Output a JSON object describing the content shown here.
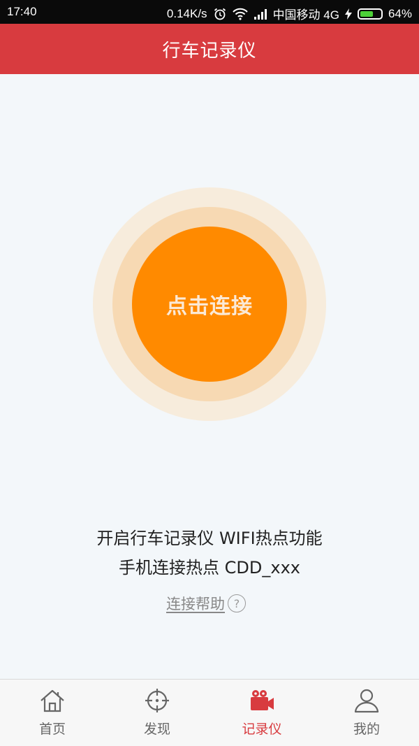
{
  "status_bar": {
    "time": "17:40",
    "speed": "0.14K/s",
    "carrier": "中国移动 4G",
    "battery": "64%",
    "battery_level": 0.64
  },
  "header": {
    "title": "行车记录仪"
  },
  "connect": {
    "button_label": "点击连接"
  },
  "instructions": {
    "line1": "开启行车记录仪 WIFI热点功能",
    "line2": "手机连接热点 CDD_xxx"
  },
  "help": {
    "label": "连接帮助",
    "icon": "?"
  },
  "tabs": [
    {
      "label": "首页",
      "icon": "home-icon",
      "active": false
    },
    {
      "label": "发现",
      "icon": "crosshair-icon",
      "active": false
    },
    {
      "label": "记录仪",
      "icon": "video-camera-icon",
      "active": true
    },
    {
      "label": "我的",
      "icon": "user-icon",
      "active": false
    }
  ],
  "colors": {
    "header_red": "#d83b3f",
    "connect_orange": "#ff8a00",
    "active_tab": "#d83b3f"
  }
}
